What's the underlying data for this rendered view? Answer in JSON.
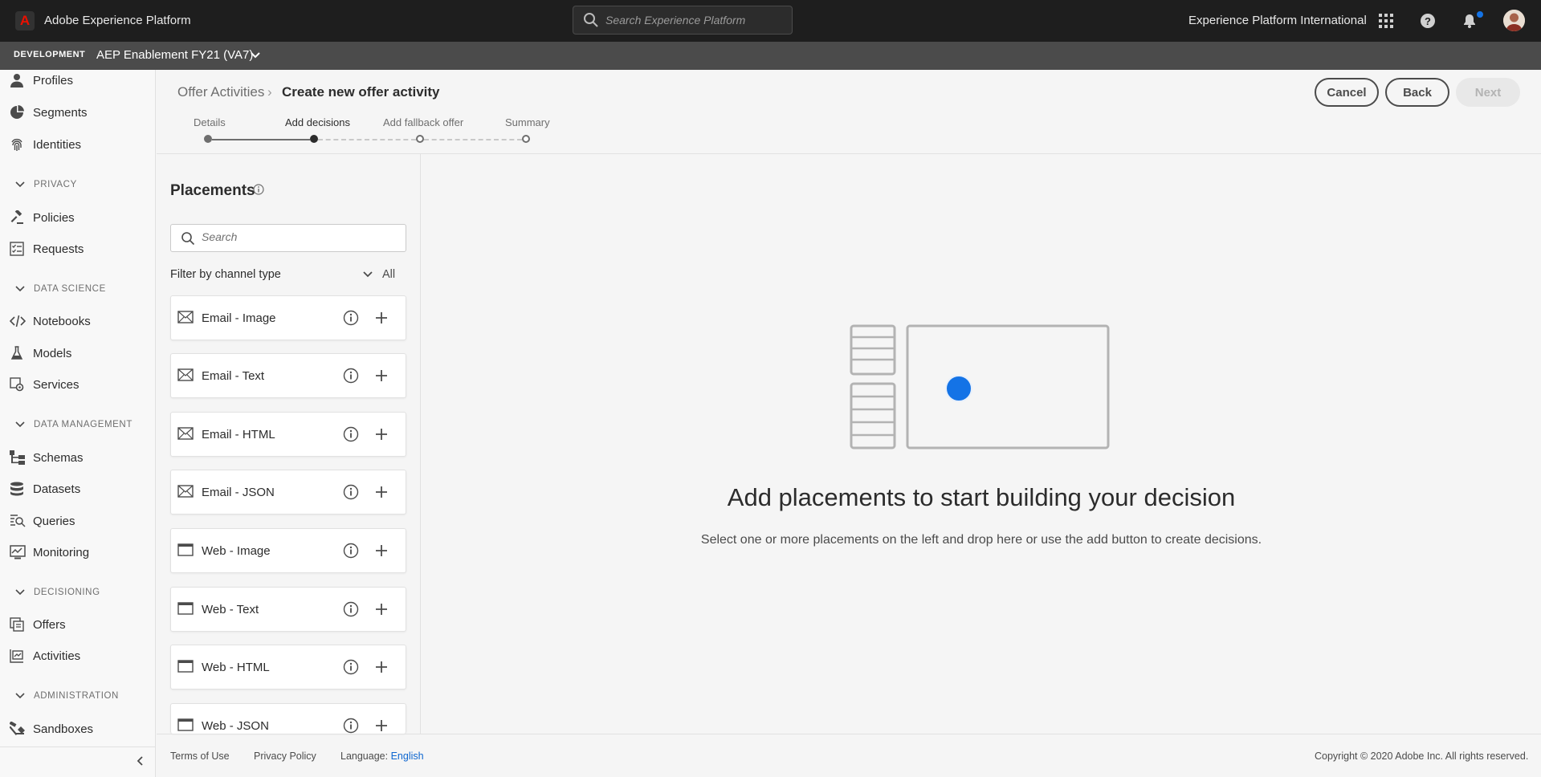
{
  "header": {
    "app_title": "Adobe Experience Platform",
    "search_placeholder": "Search Experience Platform",
    "org_name": "Experience Platform International",
    "brand_color": "#eb1000",
    "badge_color": "#1473e6"
  },
  "subheader": {
    "environment": "DEVELOPMENT",
    "sandbox_name": "AEP Enablement FY21 (VA7)"
  },
  "sidebar": {
    "items_top": [
      {
        "label": "Profiles",
        "icon": "user-icon"
      },
      {
        "label": "Segments",
        "icon": "segments-icon"
      },
      {
        "label": "Identities",
        "icon": "fingerprint-icon"
      }
    ],
    "sections": [
      {
        "title": "PRIVACY",
        "items": [
          {
            "label": "Policies",
            "icon": "gavel-icon"
          },
          {
            "label": "Requests",
            "icon": "checklist-icon"
          }
        ]
      },
      {
        "title": "DATA SCIENCE",
        "items": [
          {
            "label": "Notebooks",
            "icon": "code-icon"
          },
          {
            "label": "Models",
            "icon": "flask-icon"
          },
          {
            "label": "Services",
            "icon": "services-icon"
          }
        ]
      },
      {
        "title": "DATA MANAGEMENT",
        "items": [
          {
            "label": "Schemas",
            "icon": "schema-icon"
          },
          {
            "label": "Datasets",
            "icon": "database-icon"
          },
          {
            "label": "Queries",
            "icon": "query-icon"
          },
          {
            "label": "Monitoring",
            "icon": "monitoring-icon"
          }
        ]
      },
      {
        "title": "DECISIONING",
        "items": [
          {
            "label": "Offers",
            "icon": "offers-icon"
          },
          {
            "label": "Activities",
            "icon": "activities-icon"
          }
        ]
      },
      {
        "title": "ADMINISTRATION",
        "items": [
          {
            "label": "Sandboxes",
            "icon": "sandbox-icon"
          }
        ]
      }
    ]
  },
  "breadcrumb": {
    "parent": "Offer Activities",
    "separator": "›",
    "current": "Create new offer activity"
  },
  "actions": {
    "cancel": "Cancel",
    "back": "Back",
    "next": "Next"
  },
  "steps": [
    {
      "label": "Details",
      "state": "done"
    },
    {
      "label": "Add decisions",
      "state": "active"
    },
    {
      "label": "Add fallback offer",
      "state": "todo"
    },
    {
      "label": "Summary",
      "state": "todo"
    }
  ],
  "placements": {
    "title": "Placements",
    "search_placeholder": "Search",
    "filter_label": "Filter by channel type",
    "filter_value": "All",
    "items": [
      {
        "label": "Email - Image",
        "icon": "email-icon"
      },
      {
        "label": "Email - Text",
        "icon": "email-icon"
      },
      {
        "label": "Email - HTML",
        "icon": "email-icon"
      },
      {
        "label": "Email - JSON",
        "icon": "email-icon"
      },
      {
        "label": "Web - Image",
        "icon": "browser-icon"
      },
      {
        "label": "Web - Text",
        "icon": "browser-icon"
      },
      {
        "label": "Web - HTML",
        "icon": "browser-icon"
      },
      {
        "label": "Web - JSON",
        "icon": "browser-icon"
      }
    ]
  },
  "empty_state": {
    "title": "Add placements to start building your decision",
    "subtitle": "Select one or more placements on the left and drop here or use the add button to create decisions.",
    "accent_color": "#1473e6"
  },
  "footer": {
    "terms": "Terms of Use",
    "privacy": "Privacy Policy",
    "language_label": "Language:",
    "language_value": "English",
    "copyright": "Copyright ©  2020 Adobe Inc.  All rights reserved."
  }
}
